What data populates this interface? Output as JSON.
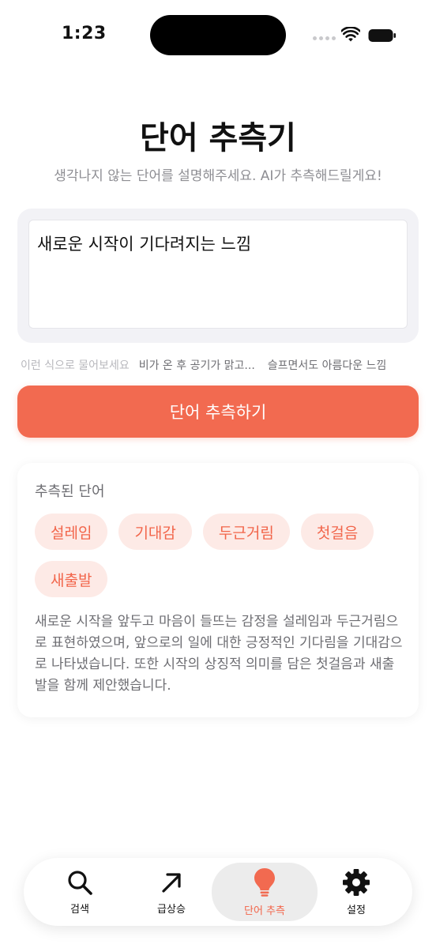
{
  "status_bar": {
    "time": "1:23"
  },
  "header": {
    "title": "단어 추측기",
    "subtitle": "생각나지 않는 단어를 설명해주세요. AI가 추측해드릴게요!"
  },
  "input": {
    "value": "새로운 시작이 기다려지는 느낌"
  },
  "examples": {
    "hint": "이런 식으로 물어보세요",
    "items": [
      "비가 온 후 공기가 맑고...",
      "슬프면서도 아름다운 느낌"
    ]
  },
  "primary_button": {
    "label": "단어 추측하기"
  },
  "result": {
    "label": "추측된 단어",
    "words": [
      "설레임",
      "기대감",
      "두근거림",
      "첫걸음",
      "새출발"
    ],
    "explanation": "새로운 시작을 앞두고 마음이 들뜨는 감정을 설레임과 두근거림으로 표현하였으며, 앞으로의 일에 대한 긍정적인 기다림을 기대감으로 나타냈습니다. 또한 시작의 상징적 의미를 담은 첫걸음과 새출발을 함께 제안했습니다."
  },
  "tab_bar": {
    "tabs": [
      {
        "label": "검색",
        "icon": "search-icon"
      },
      {
        "label": "급상승",
        "icon": "trending-arrow-icon"
      },
      {
        "label": "단어 추측",
        "icon": "lightbulb-icon",
        "active": true
      },
      {
        "label": "설정",
        "icon": "gear-icon"
      }
    ]
  },
  "colors": {
    "accent": "#f26a50",
    "chip_bg": "#fdeae6",
    "chip_text": "#f2654a"
  }
}
